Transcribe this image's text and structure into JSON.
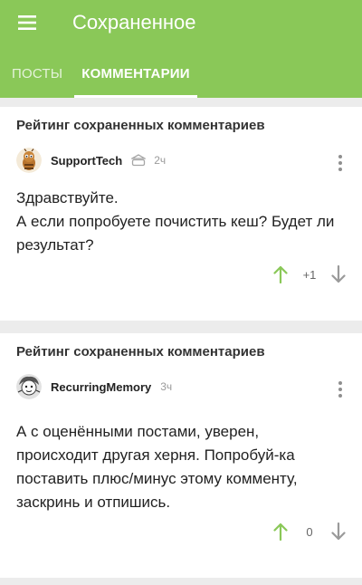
{
  "appbar": {
    "title": "Сохраненное",
    "menu_icon": "hamburger-icon"
  },
  "tabs": [
    {
      "label": "Посты",
      "active": false
    },
    {
      "label": "Комментарии",
      "active": true
    }
  ],
  "colors": {
    "accent": "#8ac858",
    "upvote": "#8ac858",
    "text_muted": "#9a9a9a"
  },
  "comments": [
    {
      "section_title": "Рейтинг сохраненных комментариев",
      "author": "SupportTech",
      "author_badge_icon": "bank-icon",
      "time": "2ч",
      "text": "Здравствуйте.\nА если попробуете почистить кеш? Будет ли результат?",
      "rating": "+1"
    },
    {
      "section_title": "Рейтинг сохраненных комментариев",
      "author": "RecurringMemory",
      "time": "3ч",
      "text": "А с оценёнными постами, уверен, происходит другая херня. Попробуй-ка поставить плюс/минус этому комменту, заскринь и отпишись.",
      "rating": "0"
    }
  ]
}
